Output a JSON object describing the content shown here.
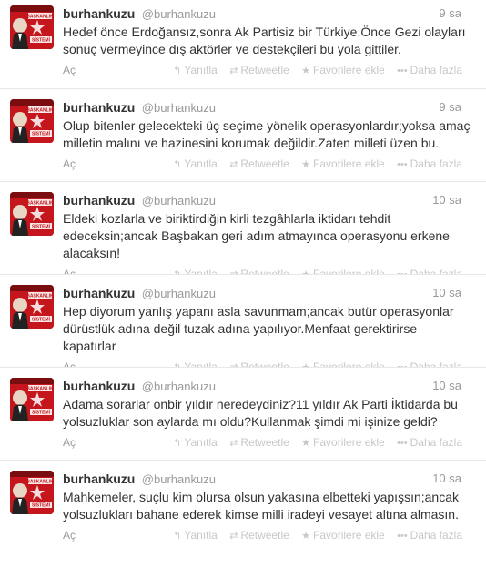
{
  "action_labels": {
    "reply": "Yanıtla",
    "retweet": "Retweetle",
    "favorite": "Favorilere ekle",
    "more": "Daha fazla"
  },
  "expand_label": "Aç",
  "icons": {
    "reply": "reply-icon",
    "retweet": "retweet-icon",
    "favorite": "star-icon",
    "more": "dots-icon"
  },
  "colors": {
    "avatar_red": "#c4161c",
    "muted": "#999999",
    "text": "#333333"
  },
  "avatar_caption": [
    "BAŞKANLIK",
    "SİSTEMİ"
  ],
  "tweets": [
    {
      "fullname": "burhankuzu",
      "username": "@burhankuzu",
      "time": "9 sa",
      "text": "Hedef önce Erdoğansız,sonra Ak Partisiz bir Türkiye.Önce Gezi olayları sonuç vermeyince dış aktörler ve destekçileri bu yola gittiler."
    },
    {
      "fullname": "burhankuzu",
      "username": "@burhankuzu",
      "time": "9 sa",
      "text": "Olup bitenler gelecekteki üç seçime yönelik operasyonlardır;yoksa amaç milletin malını ve hazinesini korumak değildir.Zaten milleti üzen bu."
    },
    {
      "fullname": "burhankuzu",
      "username": "@burhankuzu",
      "time": "10 sa",
      "text": "Eldeki kozlarla ve biriktirdiğin kirli tezgâhlarla iktidarı tehdit edeceksin;ancak Başbakan geri adım atmayınca operasyonu erkene alacaksın!"
    },
    {
      "fullname": "burhankuzu",
      "username": "@burhankuzu",
      "time": "10 sa",
      "text": "Hep diyorum yanlış yapanı asla savunmam;ancak butür operasyonlar dürüstlük adına değil tuzak adına yapılıyor.Menfaat gerektirirse kapatırlar"
    },
    {
      "fullname": "burhankuzu",
      "username": "@burhankuzu",
      "time": "10 sa",
      "text": "Adama sorarlar  onbir yıldır neredeydiniz?11 yıldır Ak Parti İktidarda bu yolsuzluklar son aylarda mı oldu?Kullanmak şimdi mi işinize geldi?"
    },
    {
      "fullname": "burhankuzu",
      "username": "@burhankuzu",
      "time": "10 sa",
      "text": "Mahkemeler, suçlu kim olursa olsun yakasına elbetteki yapışsın;ancak yolsuzlukları bahane ederek kimse milli iradeyi vesayet altına almasın."
    }
  ]
}
